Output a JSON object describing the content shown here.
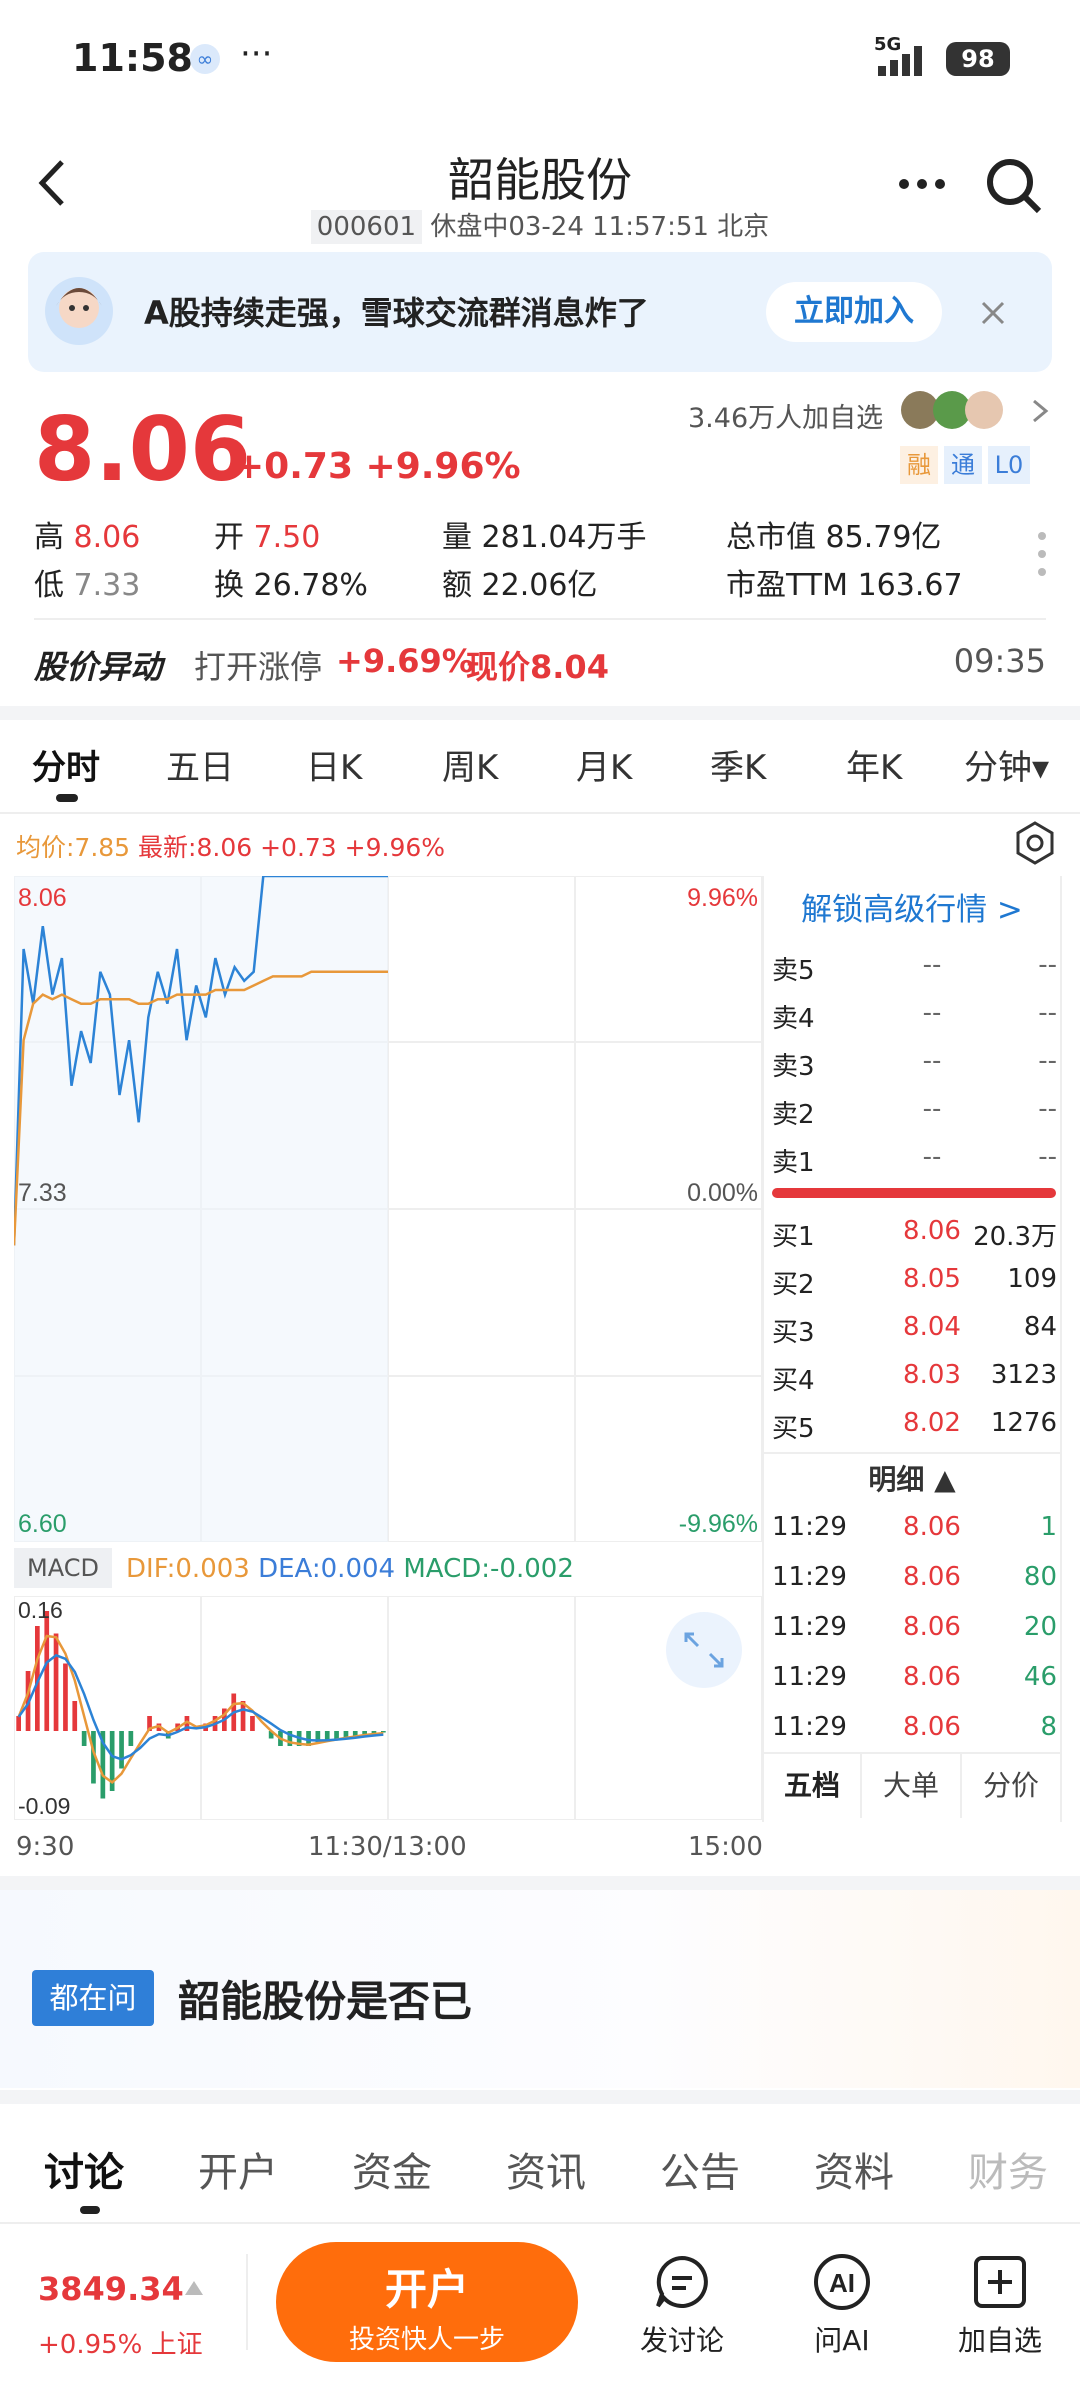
{
  "status_bar": {
    "time": "11:58",
    "dots": "···",
    "network": "5G",
    "battery": "98"
  },
  "header": {
    "title": "韶能股份",
    "code": "000601",
    "status": "休盘中03-24 11:57:51 北京"
  },
  "banner": {
    "text": "A股持续走强，雪球交流群消息炸了",
    "join_label": "立即加入"
  },
  "quote": {
    "price": "8.06",
    "change": "+0.73",
    "change_pct": "+9.96%",
    "followers": "3.46万人加自选",
    "tags": [
      "融",
      "通",
      "L0"
    ],
    "high_label": "高",
    "high": "8.06",
    "open_label": "开",
    "open": "7.50",
    "volume_label": "量",
    "volume": "281.04万手",
    "mktcap_label": "总市值",
    "mktcap": "85.79亿",
    "low_label": "低",
    "low": "7.33",
    "turnover_label": "换",
    "turnover": "26.78%",
    "amount_label": "额",
    "amount": "22.06亿",
    "pe_label": "市盈TTM",
    "pe": "163.67"
  },
  "alert": {
    "title": "股价异动",
    "desc": "打开涨停",
    "pct": "+9.69%",
    "now": "现价8.04",
    "time": "09:35"
  },
  "chart_tabs": [
    "分时",
    "五日",
    "日K",
    "周K",
    "月K",
    "季K",
    "年K",
    "分钟▾"
  ],
  "chart_info": {
    "avg": "均价:7.85",
    "latest": "最新:8.06",
    "chg": "+0.73",
    "pct": "+9.96%"
  },
  "axis": {
    "y_top": "8.06",
    "y_mid": "7.33",
    "y_bot": "6.60",
    "pct_top": "9.96%",
    "pct_mid": "0.00%",
    "pct_bot": "-9.96%",
    "x_start": "9:30",
    "x_mid": "11:30/13:00",
    "x_end": "15:00"
  },
  "macd": {
    "label": "MACD",
    "dif": "DIF:0.003",
    "dea": "DEA:0.004",
    "macd": "MACD:-0.002",
    "top": "0.16",
    "bot": "-0.09"
  },
  "orderbook": {
    "unlock": "解锁高级行情 >",
    "sells": [
      {
        "label": "卖5",
        "price": "--",
        "vol": "--"
      },
      {
        "label": "卖4",
        "price": "--",
        "vol": "--"
      },
      {
        "label": "卖3",
        "price": "--",
        "vol": "--"
      },
      {
        "label": "卖2",
        "price": "--",
        "vol": "--"
      },
      {
        "label": "卖1",
        "price": "--",
        "vol": "--"
      }
    ],
    "buys": [
      {
        "label": "买1",
        "price": "8.06",
        "vol": "20.3万"
      },
      {
        "label": "买2",
        "price": "8.05",
        "vol": "109"
      },
      {
        "label": "买3",
        "price": "8.04",
        "vol": "84"
      },
      {
        "label": "买4",
        "price": "8.03",
        "vol": "3123"
      },
      {
        "label": "买5",
        "price": "8.02",
        "vol": "1276"
      }
    ],
    "detail_label": "明细 ▲",
    "ticks": [
      {
        "time": "11:29",
        "price": "8.06",
        "vol": "1"
      },
      {
        "time": "11:29",
        "price": "8.06",
        "vol": "80"
      },
      {
        "time": "11:29",
        "price": "8.06",
        "vol": "20"
      },
      {
        "time": "11:29",
        "price": "8.06",
        "vol": "46"
      },
      {
        "time": "11:29",
        "price": "8.06",
        "vol": "8"
      }
    ],
    "tabs": [
      "五档",
      "大单",
      "分价"
    ]
  },
  "ask": {
    "tag": "都在问",
    "text": "韶能股份是否已"
  },
  "content_tabs": [
    "讨论",
    "开户",
    "资金",
    "资讯",
    "公告",
    "资料",
    "财务"
  ],
  "bottom": {
    "index_value": "3849.34",
    "index_change": "+0.95%",
    "index_name": "上证",
    "open_main": "开户",
    "open_sub": "投资快人一步",
    "post": "发讨论",
    "ai": "问AI",
    "fav": "加自选"
  },
  "chart_data": {
    "type": "line",
    "price_range": [
      6.6,
      8.06
    ],
    "series": [
      {
        "values": [
          7.25,
          7.9,
          7.78,
          7.95,
          7.8,
          7.88,
          7.6,
          7.72,
          7.65,
          7.85,
          7.8,
          7.58,
          7.7,
          7.52,
          7.75,
          7.85,
          7.78,
          7.9,
          7.7,
          7.82,
          7.75,
          7.88,
          7.8,
          7.86,
          7.83,
          7.85,
          8.06,
          8.06,
          8.06,
          8.06,
          8.06,
          8.06,
          8.06,
          8.06,
          8.06,
          8.06,
          8.06,
          8.06,
          8.06,
          8.06
        ]
      },
      {
        "values": [
          7.25,
          7.7,
          7.78,
          7.8,
          7.79,
          7.8,
          7.79,
          7.78,
          7.78,
          7.79,
          7.79,
          7.79,
          7.79,
          7.78,
          7.78,
          7.79,
          7.79,
          7.8,
          7.8,
          7.8,
          7.8,
          7.81,
          7.81,
          7.81,
          7.81,
          7.82,
          7.83,
          7.84,
          7.84,
          7.84,
          7.84,
          7.85,
          7.85,
          7.85,
          7.85,
          7.85,
          7.85,
          7.85,
          7.85,
          7.85
        ]
      }
    ],
    "macd_bars": [
      0.02,
      0.08,
      0.14,
      0.16,
      0.13,
      0.09,
      0.04,
      -0.02,
      -0.07,
      -0.09,
      -0.08,
      -0.05,
      -0.02,
      0.0,
      0.02,
      0.01,
      -0.01,
      0.01,
      0.02,
      0.0,
      0.01,
      0.02,
      0.03,
      0.05,
      0.04,
      0.02,
      0.0,
      -0.01,
      -0.02,
      -0.02,
      -0.02,
      -0.02,
      -0.015,
      -0.012,
      -0.01,
      -0.008,
      -0.006,
      -0.004,
      -0.003,
      -0.002
    ]
  }
}
